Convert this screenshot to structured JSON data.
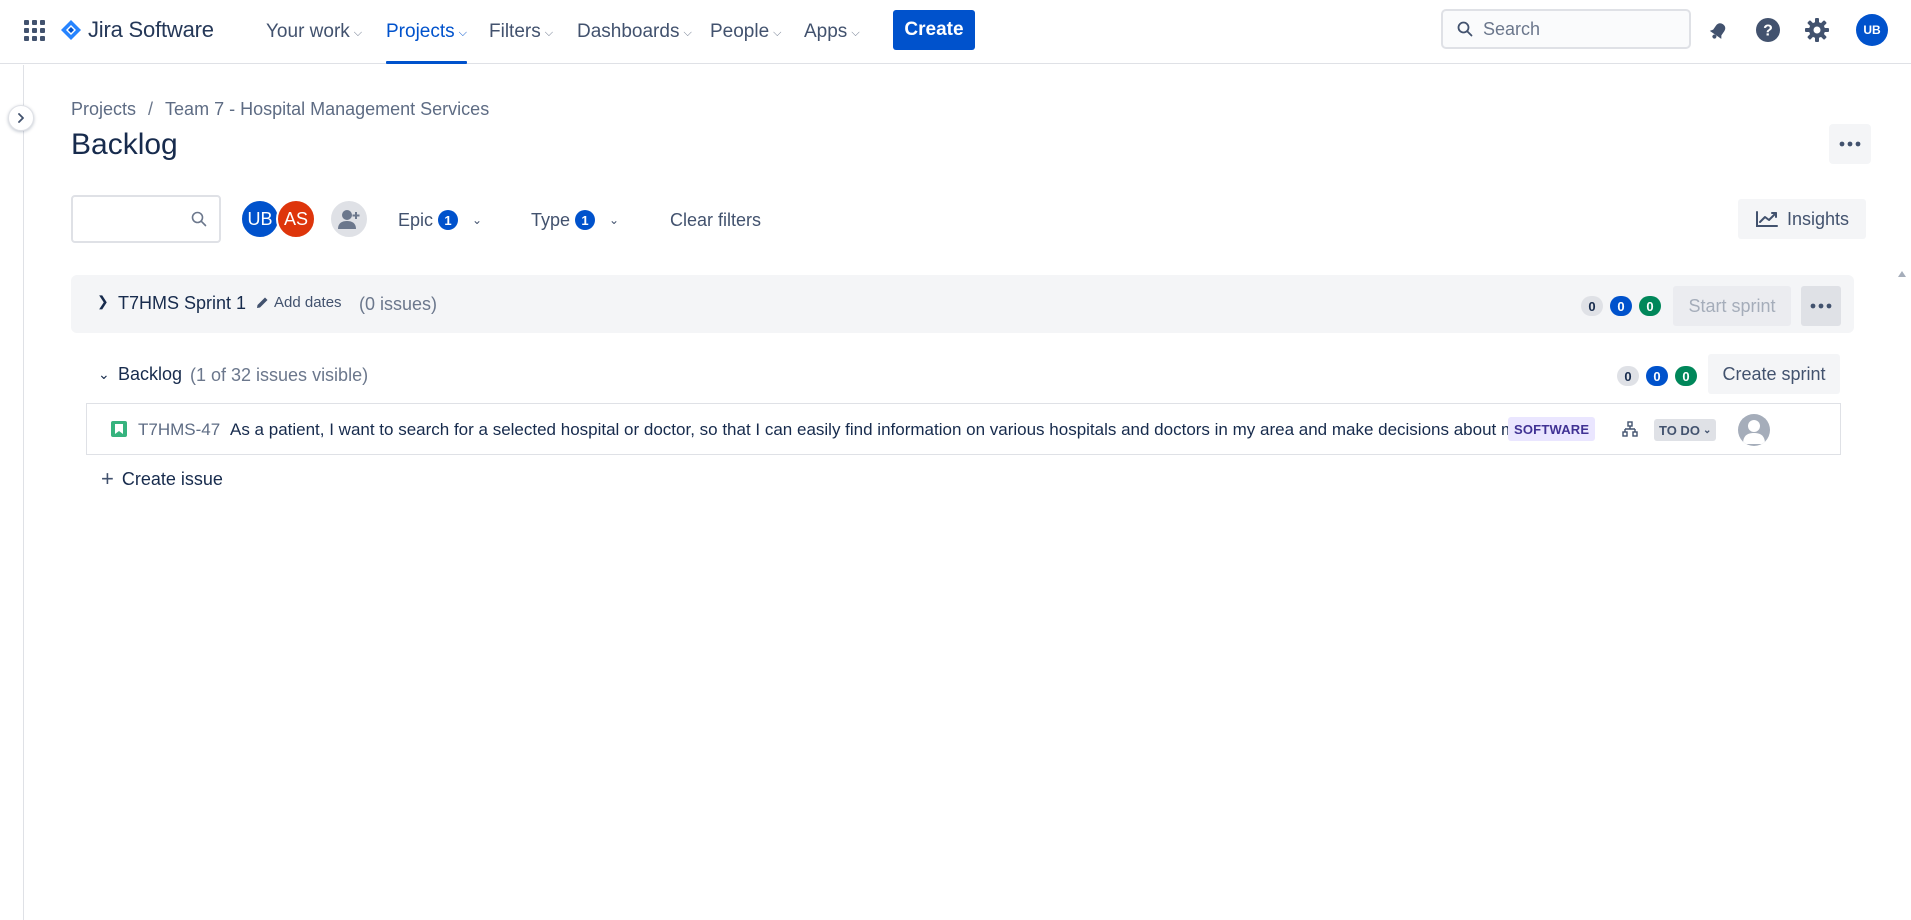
{
  "topnav": {
    "product": "Jira Software",
    "items": [
      {
        "label": "Your work"
      },
      {
        "label": "Projects"
      },
      {
        "label": "Filters"
      },
      {
        "label": "Dashboards"
      },
      {
        "label": "People"
      },
      {
        "label": "Apps"
      }
    ],
    "active_item": "Projects",
    "create_label": "Create",
    "search_placeholder": "Search",
    "user_initials": "UB"
  },
  "breadcrumb": {
    "items": [
      "Projects",
      "Team 7 - Hospital Management Services"
    ]
  },
  "page": {
    "title": "Backlog"
  },
  "filters": {
    "avatars": [
      "UB",
      "AS"
    ],
    "epic_label": "Epic",
    "epic_count": "1",
    "type_label": "Type",
    "type_count": "1",
    "clear_label": "Clear filters",
    "insights_label": "Insights"
  },
  "sprint": {
    "name": "T7HMS Sprint 1",
    "add_dates_label": "Add dates",
    "issue_count": "(0 issues)",
    "counts": [
      "0",
      "0",
      "0"
    ],
    "start_label": "Start sprint"
  },
  "backlog": {
    "name": "Backlog",
    "visible_count": "(1 of 32 issues visible)",
    "counts": [
      "0",
      "0",
      "0"
    ],
    "create_sprint_label": "Create sprint",
    "issues": [
      {
        "key": "T7HMS-47",
        "summary": "As a patient, I want to search for a selected hospital or doctor, so that I can easily find information on various hospitals and doctors in my area and make decisions about my healthcare.",
        "epic": "SOFTWARE",
        "status": "TO DO"
      }
    ],
    "create_issue_label": "Create issue"
  },
  "colors": {
    "brand": "#0052CC",
    "avatar_as": "#DE350B",
    "done_green": "#00875A",
    "epic_bg": "#EAE6FF",
    "epic_text": "#403294"
  }
}
